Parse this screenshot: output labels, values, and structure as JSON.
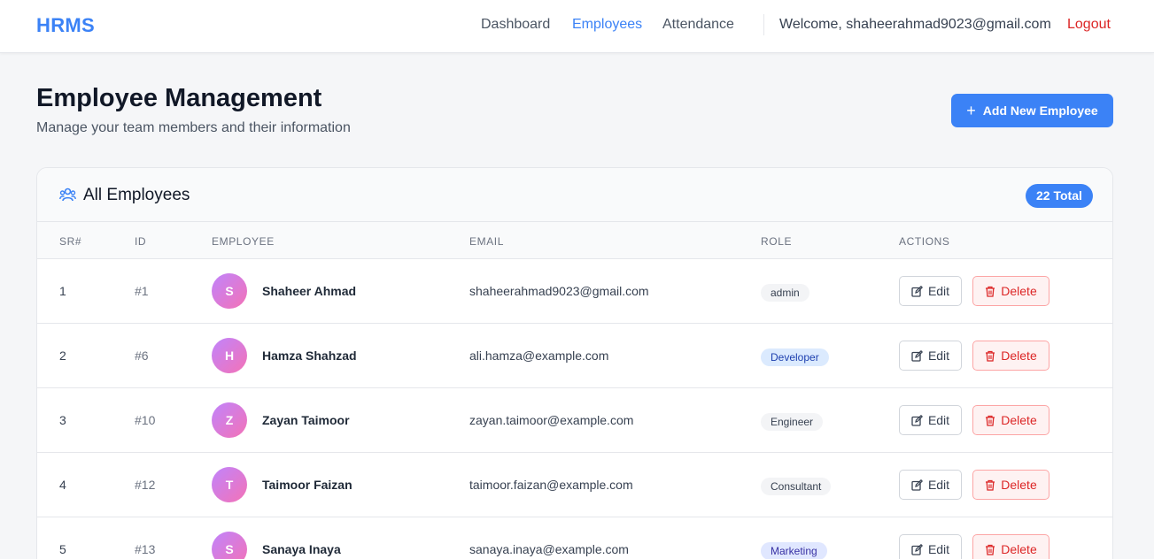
{
  "nav": {
    "brand": "HRMS",
    "links": [
      "Dashboard",
      "Employees",
      "Attendance"
    ],
    "active": "Employees",
    "welcome": "Welcome, shaheerahmad9023@gmail.com",
    "logout": "Logout"
  },
  "header": {
    "title": "Employee Management",
    "subtitle": "Manage your team members and their information",
    "add_button": "Add New Employee"
  },
  "card": {
    "title": "All Employees",
    "total_badge": "22 Total",
    "columns": [
      "SR#",
      "ID",
      "EMPLOYEE",
      "EMAIL",
      "ROLE",
      "ACTIONS"
    ],
    "edit_label": "Edit",
    "delete_label": "Delete",
    "rows": [
      {
        "sr": "1",
        "id": "#1",
        "initial": "S",
        "name": "Shaheer Ahmad",
        "email": "shaheerahmad9023@gmail.com",
        "role": "admin",
        "role_color": "gray"
      },
      {
        "sr": "2",
        "id": "#6",
        "initial": "H",
        "name": "Hamza Shahzad",
        "email": "ali.hamza@example.com",
        "role": "Developer",
        "role_color": "blue"
      },
      {
        "sr": "3",
        "id": "#10",
        "initial": "Z",
        "name": "Zayan Taimoor",
        "email": "zayan.taimoor@example.com",
        "role": "Engineer",
        "role_color": "gray"
      },
      {
        "sr": "4",
        "id": "#12",
        "initial": "T",
        "name": "Taimoor Faizan",
        "email": "taimoor.faizan@example.com",
        "role": "Consultant",
        "role_color": "gray"
      },
      {
        "sr": "5",
        "id": "#13",
        "initial": "S",
        "name": "Sanaya Inaya",
        "email": "sanaya.inaya@example.com",
        "role": "Marketing",
        "role_color": "indigo"
      }
    ]
  },
  "colors": {
    "accent": "#3b82f6",
    "danger": "#dc2626",
    "avatar_gradient_start": "#c084fc",
    "avatar_gradient_end": "#f472b6"
  }
}
